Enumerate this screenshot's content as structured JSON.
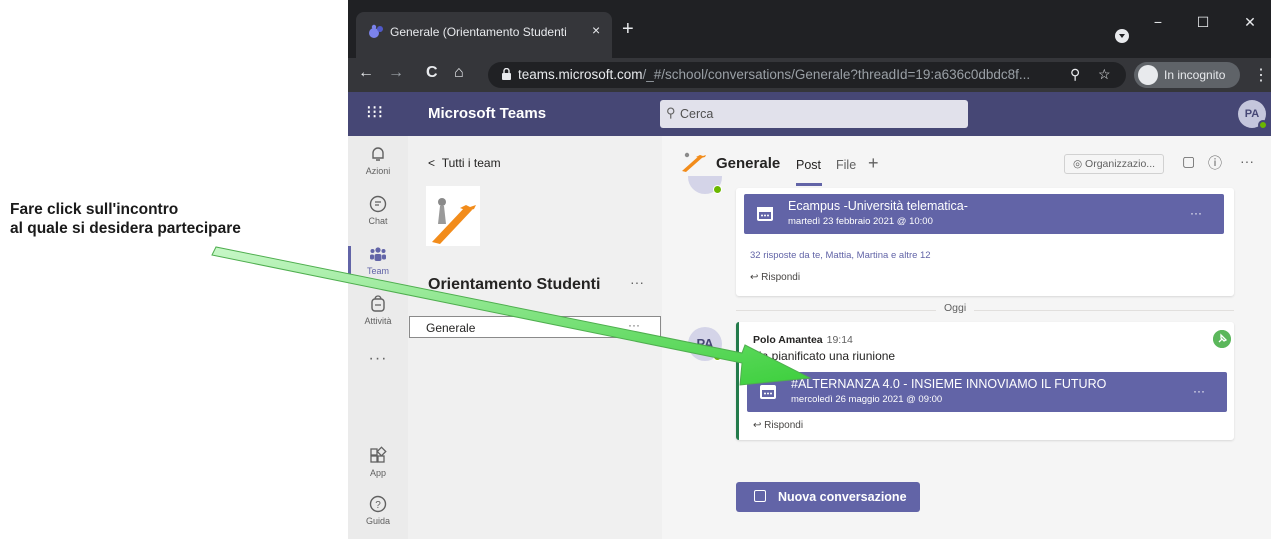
{
  "annotation": {
    "line1": "Fare click sull'incontro",
    "line2": "al quale si desidera partecipare"
  },
  "browser": {
    "tab_title": "Generale (Orientamento Studenti",
    "tab_close": "×",
    "new_tab": "+",
    "window_controls": {
      "minimize": "−",
      "maximize": "☐",
      "close": "✕"
    },
    "nav": {
      "back": "←",
      "forward": "→",
      "reload": "C",
      "home": "⌂"
    },
    "url_host": "teams.microsoft.com",
    "url_path": "/_#/school/conversations/Generale?threadId=19:a636c0dbdc8f...",
    "incognito_label": "In incognito",
    "menu": "⋮"
  },
  "teams": {
    "app_title": "Microsoft Teams",
    "search_placeholder": "Cerca",
    "user_initials": "PA"
  },
  "rail": {
    "items": [
      {
        "label": "Azioni",
        "icon": "bell-icon"
      },
      {
        "label": "Chat",
        "icon": "chat-icon"
      },
      {
        "label": "Team",
        "icon": "teams-icon"
      },
      {
        "label": "Attività",
        "icon": "assignments-icon"
      },
      {
        "label": "App",
        "icon": "apps-icon"
      },
      {
        "label": "Guida",
        "icon": "help-icon"
      }
    ],
    "more": "···"
  },
  "team_panel": {
    "back_label": "Tutti i team",
    "team_name": "Orientamento Studenti",
    "more": "···",
    "channel": "Generale",
    "channel_more": "···"
  },
  "channel": {
    "title": "Generale",
    "tabs": {
      "post": "Post",
      "file": "File",
      "add": "+"
    },
    "org_label": "Organizzazio...",
    "info": "ⓘ",
    "more": "···"
  },
  "messages": {
    "old_meeting": {
      "title": "Ecampus -Università telematica-",
      "date": "martedì 23 febbraio 2021 @ 10:00",
      "replies": "32 risposte da te, Mattia, Martina e altre 12",
      "reply": "Rispondi",
      "more": "···"
    },
    "day_separator": "Oggi",
    "new_message": {
      "author": "Polo Amantea",
      "time": "19:14",
      "initials": "PA",
      "text": "Ha pianificato una riunione",
      "meeting_title": "#ALTERNANZA 4.0 - INSIEME INNOVIAMO IL FUTURO",
      "meeting_date": "mercoledì 26 maggio 2021 @ 09:00",
      "reply": "Rispondi",
      "more": "···"
    },
    "new_conversation": "Nuova conversazione"
  },
  "colors": {
    "teams_purple": "#464775",
    "accent": "#6264a7",
    "presence_green": "#6bb700",
    "arrow_green": "#5fe35f"
  }
}
